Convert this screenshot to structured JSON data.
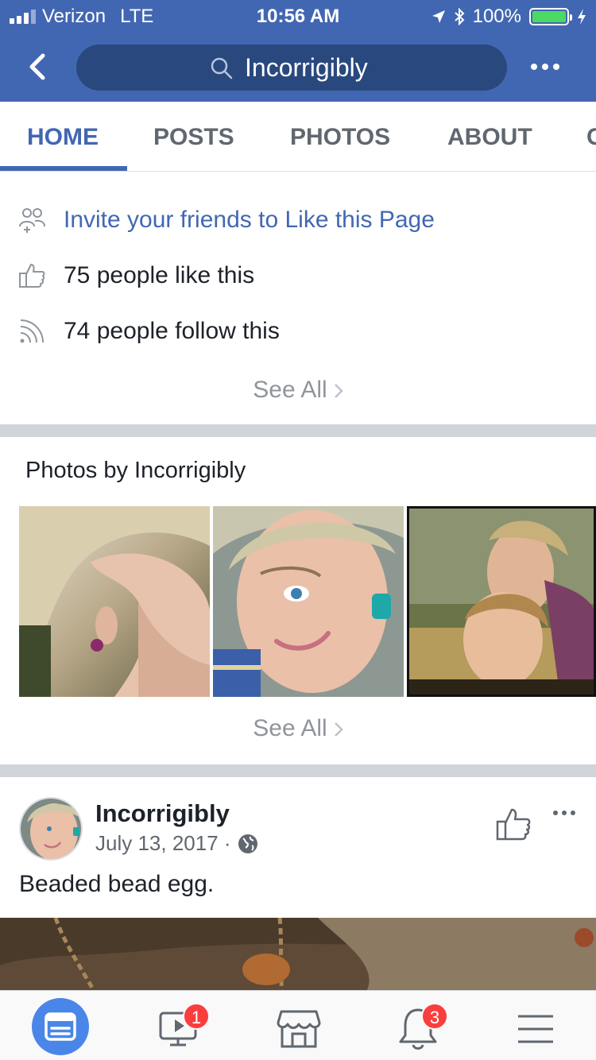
{
  "status_bar": {
    "carrier": "Verizon",
    "network": "LTE",
    "time": "10:56 AM",
    "battery_percent": "100%",
    "battery_level": 1.0
  },
  "header": {
    "search_text": "Incorrigibly",
    "color": "#4267b2"
  },
  "tabs": [
    {
      "label": "HOME",
      "active": true
    },
    {
      "label": "POSTS",
      "active": false
    },
    {
      "label": "PHOTOS",
      "active": false
    },
    {
      "label": "ABOUT",
      "active": false
    },
    {
      "label": "C",
      "active": false
    }
  ],
  "community": {
    "invite": "Invite your friends to Like this Page",
    "likes": "75 people like this",
    "follows": "74 people follow this",
    "see_all": "See All"
  },
  "photos": {
    "title": "Photos by Incorrigibly",
    "see_all": "See All"
  },
  "post": {
    "author": "Incorrigibly",
    "date": "July 13, 2017 ·",
    "text": "Beaded bead egg."
  },
  "bottom_nav": {
    "items": [
      {
        "icon": "news-feed-icon",
        "active": true
      },
      {
        "icon": "watch-icon",
        "badge": "1"
      },
      {
        "icon": "marketplace-icon"
      },
      {
        "icon": "notifications-icon",
        "badge": "3"
      },
      {
        "icon": "menu-icon"
      }
    ]
  },
  "colors": {
    "brand_blue": "#4267b2",
    "dark_blue": "#29487d",
    "badge_red": "#fa3e3e",
    "battery_green": "#4cd964"
  }
}
